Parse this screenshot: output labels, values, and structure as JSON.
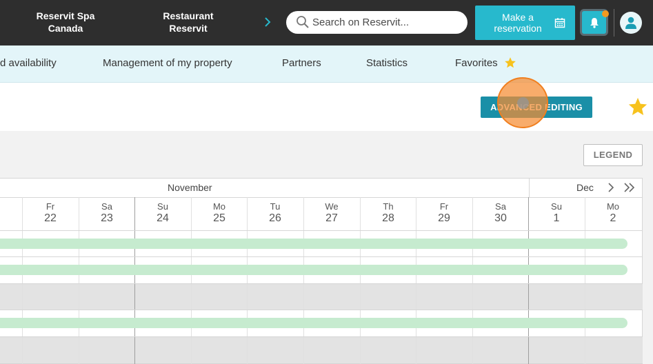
{
  "header": {
    "brand_spa": "Reservit Spa Canada",
    "brand_restaurant": "Restaurant Reservit",
    "search_placeholder": "Search on Reservit...",
    "make_reservation": "Make a reservation",
    "notification_badge_color": "#f39a1f",
    "accent_color": "#27b9cd"
  },
  "nav": {
    "items": [
      "d availability",
      "Management of my property",
      "Partners",
      "Statistics",
      "Favorites"
    ]
  },
  "toolbar": {
    "advanced_editing": "ADVANCED EDITING",
    "legend": "LEGEND"
  },
  "calendar": {
    "months": [
      "November",
      "Dec"
    ],
    "days": [
      {
        "name": "Fr",
        "num": "22"
      },
      {
        "name": "Sa",
        "num": "23"
      },
      {
        "name": "Su",
        "num": "24"
      },
      {
        "name": "Mo",
        "num": "25"
      },
      {
        "name": "Tu",
        "num": "26"
      },
      {
        "name": "We",
        "num": "27"
      },
      {
        "name": "Th",
        "num": "28"
      },
      {
        "name": "Fr",
        "num": "29"
      },
      {
        "name": "Sa",
        "num": "30"
      },
      {
        "name": "Su",
        "num": "1"
      },
      {
        "name": "Mo",
        "num": "2"
      }
    ],
    "availability_color": "#c6ebcf"
  }
}
